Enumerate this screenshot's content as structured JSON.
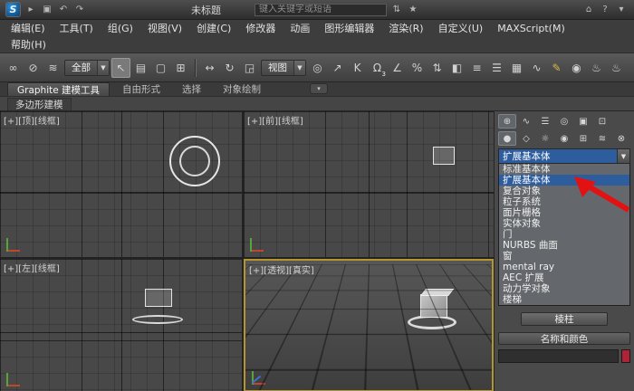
{
  "colors": {
    "selection_blue": "#2e5d9e",
    "active_viewport_border": "#b5952f",
    "annotation_red": "#e31212",
    "color_swatch": "#b02236"
  },
  "title_bar": {
    "title": "未标题",
    "search_placeholder": "键入关键字或短语",
    "qat_icons": [
      {
        "name": "workspace-icon",
        "glyph": "▸"
      },
      {
        "name": "save-icon",
        "glyph": "▣"
      },
      {
        "name": "undo-icon",
        "glyph": "↶"
      },
      {
        "name": "redo-icon",
        "glyph": "↷"
      }
    ],
    "search_side_icons": [
      {
        "name": "search-history-icon",
        "glyph": "⇅"
      },
      {
        "name": "favorites-icon",
        "glyph": "★"
      }
    ],
    "right_icons": [
      {
        "name": "communication-center-icon",
        "glyph": "⌂"
      },
      {
        "name": "help-icon",
        "glyph": "?"
      },
      {
        "name": "infocenter-more-icon",
        "glyph": "▾"
      }
    ]
  },
  "menu": {
    "row1": [
      "编辑(E)",
      "工具(T)",
      "组(G)",
      "视图(V)",
      "创建(C)",
      "修改器",
      "动画",
      "图形编辑器",
      "渲染(R)",
      "自定义(U)",
      "MAXScript(M)"
    ],
    "row2": [
      "帮助(H)"
    ]
  },
  "toolbar": {
    "link_icons": [
      {
        "name": "select-and-link-icon",
        "glyph": "∞"
      },
      {
        "name": "unlink-selection-icon",
        "glyph": "⊘"
      },
      {
        "name": "bind-to-space-warp-icon",
        "glyph": "≋"
      }
    ],
    "selection_filter_value": "全部",
    "selection_icons": [
      {
        "name": "select-object-icon",
        "glyph": "↖",
        "active": true
      },
      {
        "name": "select-by-name-icon",
        "glyph": "▤"
      },
      {
        "name": "rectangular-selection-region-icon",
        "glyph": "▢"
      },
      {
        "name": "window-crossing-icon",
        "glyph": "⊞"
      }
    ],
    "transform_icons": [
      {
        "name": "select-and-move-icon",
        "glyph": "↔"
      },
      {
        "name": "select-and-rotate-icon",
        "glyph": "↻"
      },
      {
        "name": "select-and-scale-icon",
        "glyph": "◲"
      }
    ],
    "coord_system_value": "视图",
    "right_icons": [
      {
        "name": "use-pivot-point-center-icon",
        "glyph": "◎"
      },
      {
        "name": "select-and-manipulate-icon",
        "glyph": "↗"
      },
      {
        "name": "keyboard-override-icon",
        "glyph": "K"
      },
      {
        "name": "snap-toggle-3d-icon",
        "glyph": "Ω",
        "badge": "3"
      },
      {
        "name": "angle-snap-icon",
        "glyph": "∠"
      },
      {
        "name": "percent-snap-icon",
        "glyph": "%"
      },
      {
        "name": "spinner-snap-icon",
        "glyph": "⇅"
      },
      {
        "name": "mirror-icon",
        "glyph": "◧"
      },
      {
        "name": "align-icon",
        "glyph": "≡"
      },
      {
        "name": "layer-manager-icon",
        "glyph": "☰"
      },
      {
        "name": "graphite-ribbon-toggle-icon",
        "glyph": "▦"
      },
      {
        "name": "curve-editor-icon",
        "glyph": "∿"
      },
      {
        "name": "pencil-icon",
        "glyph": "✎",
        "color": "#d6b94c"
      },
      {
        "name": "material-editor-icon",
        "glyph": "◉"
      },
      {
        "name": "render-setup-icon",
        "glyph": "♨"
      },
      {
        "name": "render-production-icon",
        "glyph": "♨"
      }
    ]
  },
  "ribbon": {
    "tabs": [
      {
        "label": "Graphite 建模工具",
        "active": true
      },
      {
        "label": "自由形式",
        "active": false
      },
      {
        "label": "选择",
        "active": false
      },
      {
        "label": "对象绘制",
        "active": false
      }
    ],
    "panel_label": "多边形建模"
  },
  "viewports": {
    "top": {
      "label": "[+][顶][线框]"
    },
    "front": {
      "label": "[+][前][线框]"
    },
    "left": {
      "label": "[+][左][线框]"
    },
    "perspective": {
      "label": "[+][透视][真实]"
    }
  },
  "command_panel": {
    "tab_icons": [
      {
        "name": "create-tab-icon",
        "glyph": "⊕",
        "active": true
      },
      {
        "name": "modify-tab-icon",
        "glyph": "∿"
      },
      {
        "name": "hierarchy-tab-icon",
        "glyph": "☰"
      },
      {
        "name": "motion-tab-icon",
        "glyph": "◎"
      },
      {
        "name": "display-tab-icon",
        "glyph": "▣"
      },
      {
        "name": "utilities-tab-icon",
        "glyph": "⊡"
      }
    ],
    "category_icons": [
      {
        "name": "geometry-category-icon",
        "glyph": "●",
        "active": true
      },
      {
        "name": "shapes-category-icon",
        "glyph": "◇"
      },
      {
        "name": "lights-category-icon",
        "glyph": "☼"
      },
      {
        "name": "cameras-category-icon",
        "glyph": "◉"
      },
      {
        "name": "helpers-category-icon",
        "glyph": "⊞"
      },
      {
        "name": "space-warps-category-icon",
        "glyph": "≋"
      },
      {
        "name": "systems-category-icon",
        "glyph": "⊗"
      }
    ],
    "subcategory_dropdown": {
      "value": "扩展基本体",
      "items": [
        "标准基本体",
        "扩展基本体",
        "复合对象",
        "粒子系统",
        "面片栅格",
        "实体对象",
        "门",
        "NURBS 曲面",
        "窗",
        "mental ray",
        "AEC 扩展",
        "动力学对象",
        "楼梯"
      ],
      "selected_index": 1
    },
    "object_type_button": "棱柱",
    "name_color_rollout": "名称和颜色",
    "object_name_value": ""
  }
}
